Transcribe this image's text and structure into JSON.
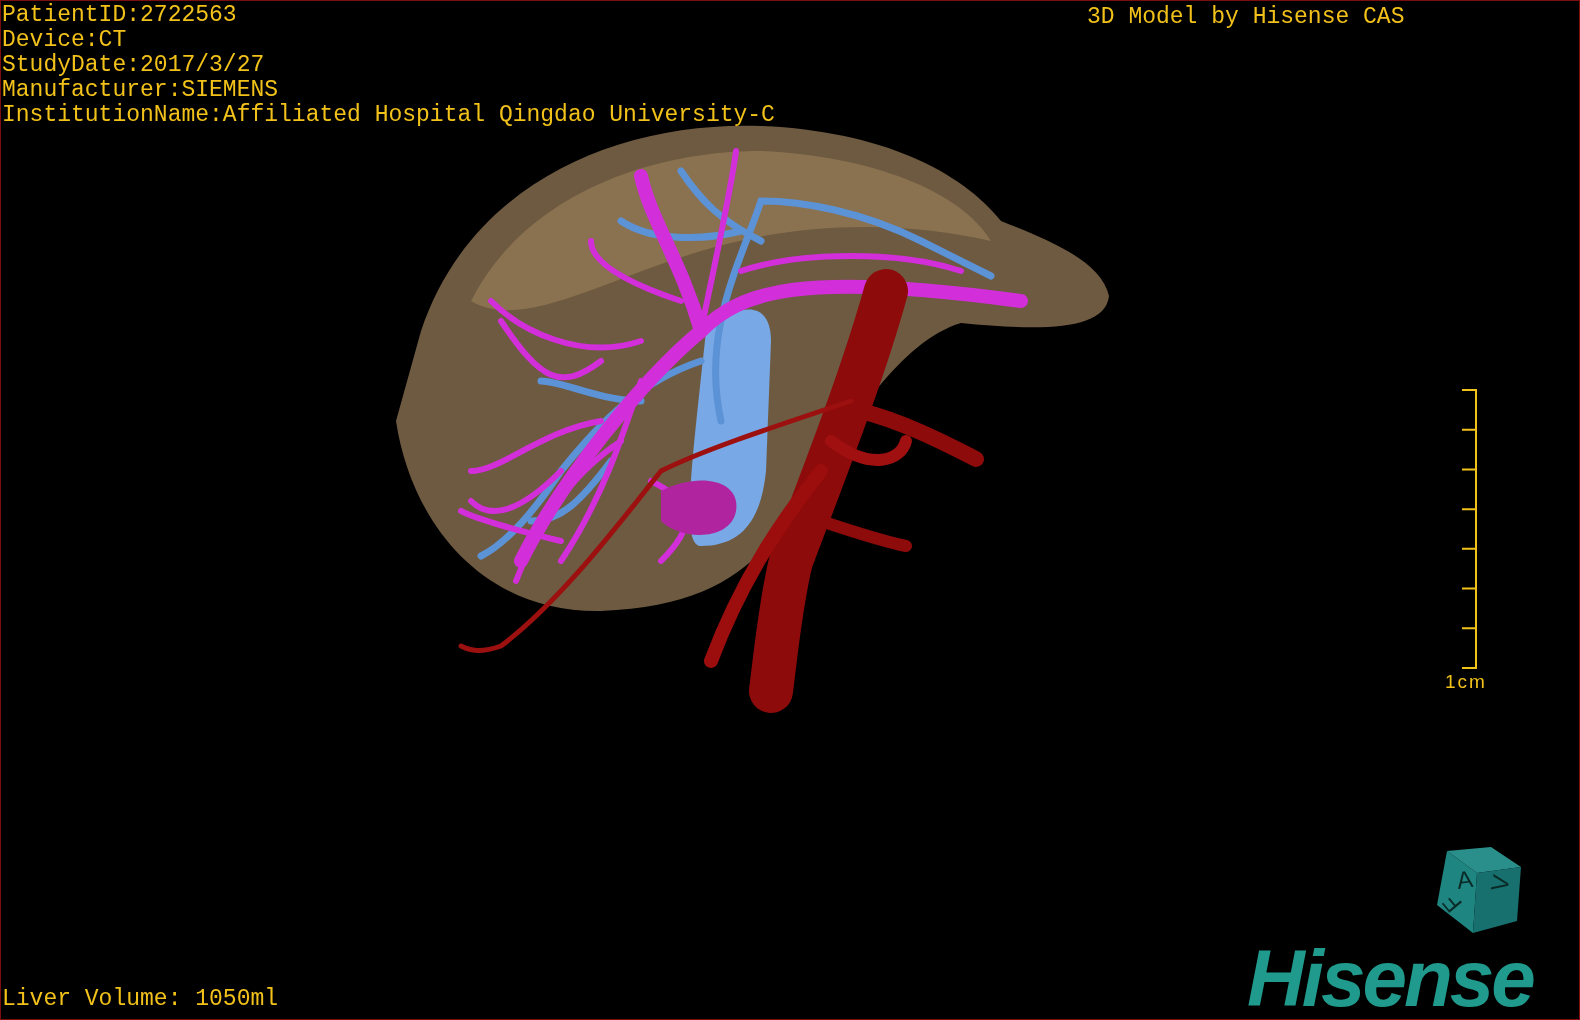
{
  "patient_info": [
    "PatientID:2722563",
    "Device:CT",
    "StudyDate:2017/3/27",
    "Manufacturer:SIEMENS",
    "InstitutionName:Affiliated Hospital Qingdao University-C"
  ],
  "title": "3D Model by Hisense CAS",
  "scale_bar": {
    "label": "1cm"
  },
  "orientation_cube": {
    "labels": [
      "A",
      "V",
      "F"
    ]
  },
  "logo": "Hisense",
  "liver_volume": "Liver Volume: 1050ml"
}
